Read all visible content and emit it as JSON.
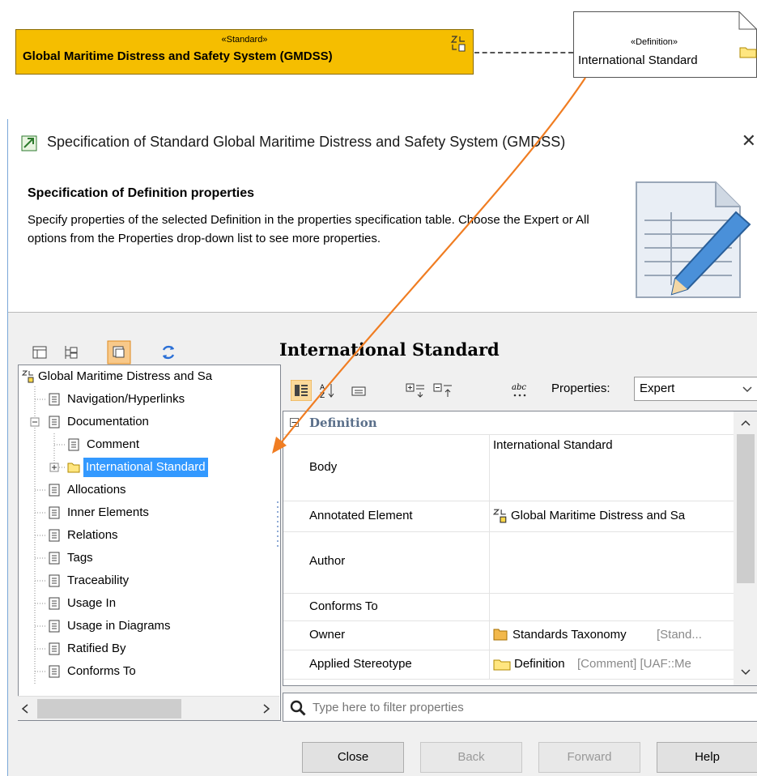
{
  "diagram": {
    "standard_stereotype": "«Standard»",
    "standard_name": "Global Maritime Distress and Safety System (GMDSS)",
    "definition_stereotype": "«Definition»",
    "definition_name": "International Standard",
    "colors": {
      "standard_fill": "#f5be00",
      "arrow": "#f07d22"
    }
  },
  "dialog": {
    "title": "Specification of Standard Global Maritime Distress and Safety System (GMDSS)",
    "close_glyph": "✕",
    "header_title": "Specification of Definition properties",
    "header_description": "Specify properties of the selected Definition in the properties specification table. Choose the Expert or All options from the Properties drop-down list to see more properties.",
    "tree": {
      "root": "Global Maritime Distress and Sa",
      "items": [
        {
          "label": "Navigation/Hyperlinks"
        },
        {
          "label": "Documentation"
        },
        {
          "label": "Comment"
        },
        {
          "label": "International Standard"
        },
        {
          "label": "Allocations"
        },
        {
          "label": "Inner Elements"
        },
        {
          "label": "Relations"
        },
        {
          "label": "Tags"
        },
        {
          "label": "Traceability"
        },
        {
          "label": "Usage In"
        },
        {
          "label": "Usage in Diagrams"
        },
        {
          "label": "Ratified By"
        },
        {
          "label": "Conforms To"
        }
      ]
    },
    "element_title": "International Standard",
    "properties_label": "Properties:",
    "properties_value": "Expert",
    "section": "Definition",
    "rows": [
      {
        "name": "Body",
        "value": "International Standard",
        "extra": ""
      },
      {
        "name": "Annotated Element",
        "value": "Global Maritime Distress and Sa",
        "extra": ""
      },
      {
        "name": "Author",
        "value": "",
        "extra": ""
      },
      {
        "name": "Conforms To",
        "value": "",
        "extra": ""
      },
      {
        "name": "Owner",
        "value": "Standards Taxonomy",
        "extra": "[Stand..."
      },
      {
        "name": "Applied Stereotype",
        "value": "Definition",
        "extra": "[Comment] [UAF::Me"
      }
    ],
    "filter_placeholder": "Type here to filter properties",
    "buttons": {
      "close": "Close",
      "back": "Back",
      "forward": "Forward",
      "help": "Help"
    }
  }
}
